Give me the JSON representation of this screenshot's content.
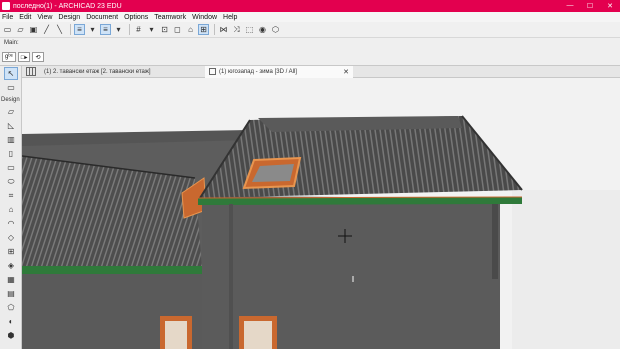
{
  "window": {
    "title": "последно(1) - ARCHICAD 23 EDU",
    "controls": [
      "—",
      "☐",
      "✕"
    ]
  },
  "menu": [
    "File",
    "Edit",
    "View",
    "Design",
    "Document",
    "Options",
    "Teamwork",
    "Window",
    "Help"
  ],
  "toolbar": {
    "buttons": [
      "new-icon",
      "open-icon",
      "save-icon",
      "pick-icon",
      "inject-icon",
      "layers-icon",
      "pen-icon",
      "fill-icon",
      "grid-icon",
      "snap-icon",
      "magic-icon",
      "trace-icon",
      "select-icon",
      "renovation-icon",
      "split-icon",
      "adjust-icon",
      "offset-icon",
      "group-icon",
      "view-icon",
      "3d-icon"
    ]
  },
  "info_box": {
    "label": "Main:",
    "controls": [
      "gᵇᵉ",
      "□▸",
      "⟲"
    ]
  },
  "toolbox": {
    "select_tools": [
      "arrow-icon",
      "marquee-icon"
    ],
    "group_label": "Design",
    "design_tools": [
      "wall-icon",
      "door-icon",
      "window-icon",
      "column-icon",
      "beam-icon",
      "slab-icon",
      "stair-icon",
      "roof-icon",
      "shell-icon",
      "skylight-icon",
      "railing-icon",
      "morph-icon",
      "zone-icon",
      "curtain-wall-icon",
      "object-icon",
      "lamp-icon",
      "mesh-icon"
    ]
  },
  "tabs": [
    {
      "label": "(1) 2. тавански етаж [2. тавански етаж]",
      "active": false
    },
    {
      "label": "(1) югозапад - зима [3D / All]",
      "active": true
    }
  ],
  "colors": {
    "titlebar": "#e3004f",
    "wall": "#5b5b5b",
    "roof": "#4e4e4e",
    "trim": "#d2733a",
    "parapet": "#2f7a3a"
  }
}
